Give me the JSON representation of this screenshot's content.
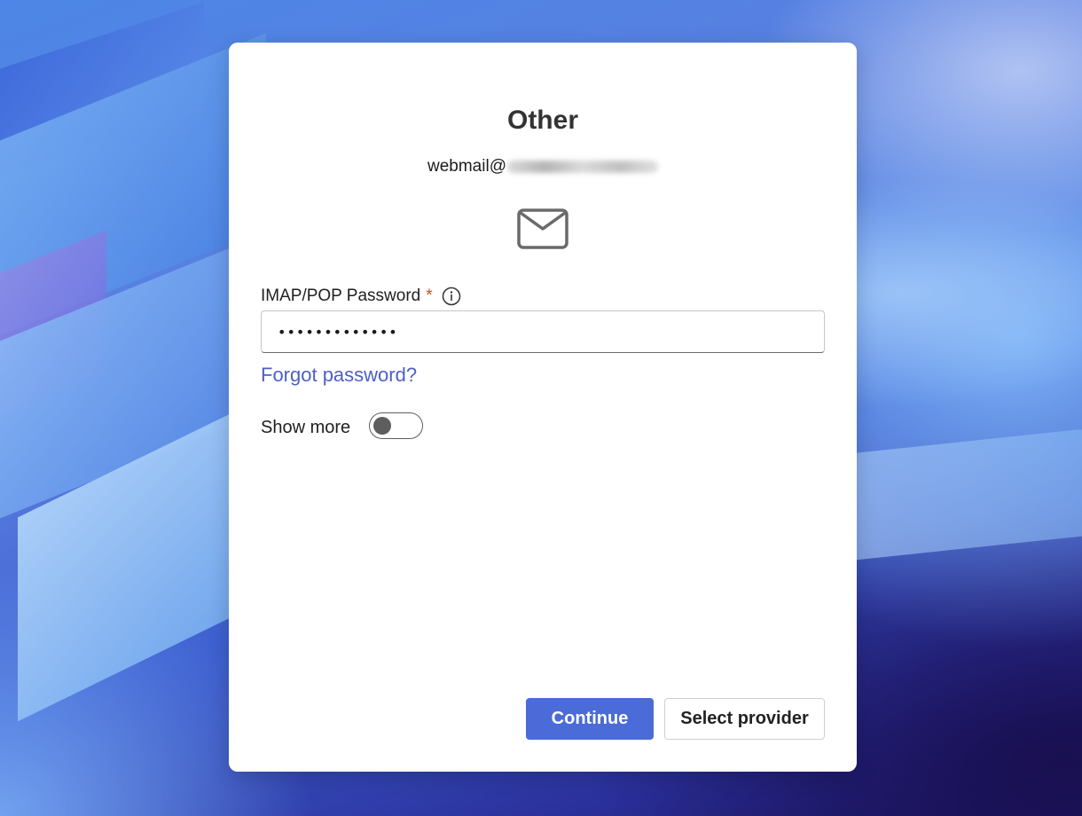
{
  "dialog": {
    "title": "Other",
    "email_prefix": "webmail@",
    "email_domain_redacted": true,
    "icon": "mail-icon"
  },
  "password_field": {
    "label": "IMAP/POP Password",
    "required_marker": "*",
    "info_icon": "info-icon",
    "value": "•••••••••••••",
    "masked": true
  },
  "forgot_password": {
    "label": "Forgot password?",
    "color": "#4c5fc7"
  },
  "show_more": {
    "label": "Show more",
    "toggled": false
  },
  "buttons": {
    "continue_label": "Continue",
    "select_provider_label": "Select provider",
    "primary_color": "#4a6bd8"
  }
}
